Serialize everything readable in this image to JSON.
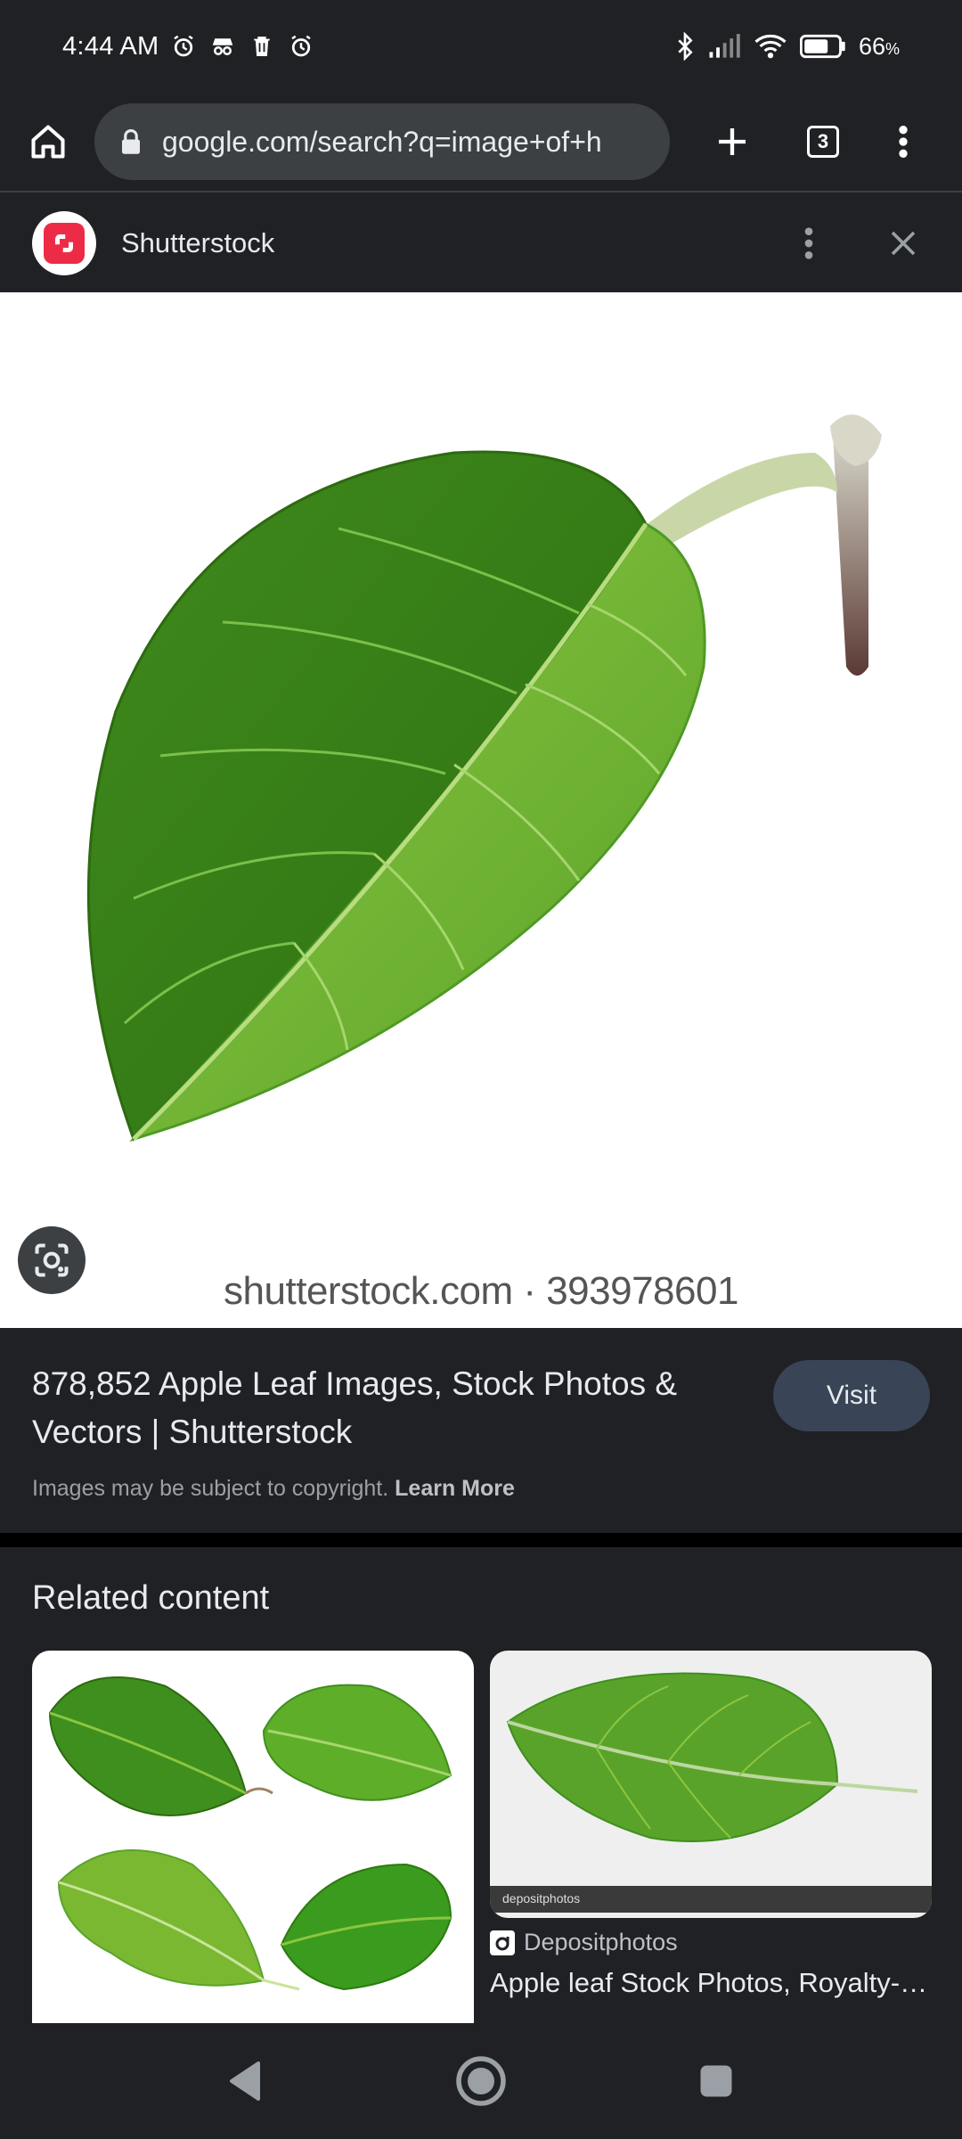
{
  "status_bar": {
    "time": "4:44 AM",
    "battery_percent": "66",
    "battery_unit": "%",
    "icons": [
      "alarm-icon",
      "incognito-icon",
      "trash-icon",
      "alarm-icon",
      "bluetooth-icon",
      "signal-icon",
      "wifi-icon",
      "battery-icon"
    ]
  },
  "toolbar": {
    "url": "google.com/search?q=image+of+h",
    "tab_count": "3"
  },
  "source": {
    "name": "Shutterstock"
  },
  "main_image": {
    "watermark": "shutterstock.com · 393978601"
  },
  "result": {
    "title": "878,852 Apple Leaf Images, Stock Photos & Vectors | Shutterstock",
    "visit_label": "Visit",
    "copyright_text": "Images may be subject to copyright.",
    "learn_more": "Learn More"
  },
  "related": {
    "heading": "Related content",
    "cards": [
      {
        "source": "",
        "title": ""
      },
      {
        "source": "Depositphotos",
        "title": "Apple leaf Stock Photos, Royalty-free Apple leaf Images",
        "banner": "depositphotos"
      }
    ]
  },
  "colors": {
    "background": "#202124",
    "url_bar": "#3c4043",
    "visit_button": "#394457",
    "shutterstock_red": "#ee2b47",
    "leaf_green": "#4f9a25"
  }
}
